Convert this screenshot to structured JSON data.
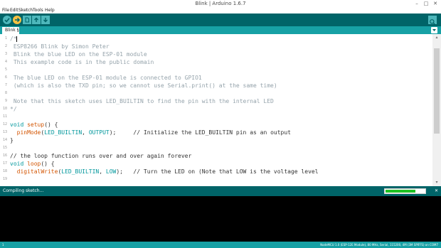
{
  "window": {
    "title": "Blink | Arduino 1.6.7"
  },
  "menu": [
    "File",
    "Edit",
    "Sketch",
    "Tools",
    "Help"
  ],
  "tabs": [
    {
      "label": "Blink §"
    }
  ],
  "editor": {
    "lines": [
      {
        "n": "1",
        "segs": [
          {
            "t": "/*",
            "c": "cm"
          }
        ]
      },
      {
        "n": "2",
        "segs": [
          {
            "t": " ESP8266 Blink by Simon Peter",
            "c": "cm"
          }
        ]
      },
      {
        "n": "3",
        "segs": [
          {
            "t": " Blink the blue LED on the ESP-01 module",
            "c": "cm"
          }
        ]
      },
      {
        "n": "4",
        "segs": [
          {
            "t": " This example code is in the public domain",
            "c": "cm"
          }
        ]
      },
      {
        "n": "5",
        "segs": []
      },
      {
        "n": "6",
        "segs": [
          {
            "t": " The blue LED on the ESP-01 module is connected to GPIO1",
            "c": "cm"
          }
        ]
      },
      {
        "n": "7",
        "segs": [
          {
            "t": " (which is also the TXD pin; so we cannot use Serial.print() at the same time)",
            "c": "cm"
          }
        ]
      },
      {
        "n": "8",
        "segs": []
      },
      {
        "n": "9",
        "segs": [
          {
            "t": " Note that this sketch uses LED_BUILTIN to find the pin with the internal LED",
            "c": "cm"
          }
        ]
      },
      {
        "n": "10",
        "segs": [
          {
            "t": "*/",
            "c": "cm"
          }
        ]
      },
      {
        "n": "11",
        "segs": []
      },
      {
        "n": "12",
        "segs": [
          {
            "t": "void",
            "c": "kw"
          },
          {
            "t": " "
          },
          {
            "t": "setup",
            "c": "fn"
          },
          {
            "t": "() {"
          }
        ]
      },
      {
        "n": "13",
        "segs": [
          {
            "t": "  "
          },
          {
            "t": "pinMode",
            "c": "fn"
          },
          {
            "t": "("
          },
          {
            "t": "LED_BUILTIN",
            "c": "cn"
          },
          {
            "t": ", "
          },
          {
            "t": "OUTPUT",
            "c": "cn"
          },
          {
            "t": ");     // Initialize the LED_BUILTIN pin as an output"
          }
        ]
      },
      {
        "n": "14",
        "segs": [
          {
            "t": "}"
          }
        ]
      },
      {
        "n": "15",
        "segs": []
      },
      {
        "n": "16",
        "segs": [
          {
            "t": "// the loop function runs over and over again forever"
          }
        ]
      },
      {
        "n": "17",
        "segs": [
          {
            "t": "void",
            "c": "kw"
          },
          {
            "t": " "
          },
          {
            "t": "loop",
            "c": "fn"
          },
          {
            "t": "() {"
          }
        ]
      },
      {
        "n": "18",
        "segs": [
          {
            "t": "  "
          },
          {
            "t": "digitalWrite",
            "c": "fn"
          },
          {
            "t": "("
          },
          {
            "t": "LED_BUILTIN",
            "c": "cn"
          },
          {
            "t": ", "
          },
          {
            "t": "LOW",
            "c": "cn"
          },
          {
            "t": ");   // Turn the LED on (Note that LOW is the voltage level"
          }
        ]
      },
      {
        "n": "19",
        "segs": []
      }
    ]
  },
  "status": {
    "message": "Compiling sketch...",
    "progress": 0.77
  },
  "footer": {
    "line": "1",
    "board": "NodeMCU 1.0 (ESP-12E Module), 80 MHz, Serial, 115200, 4M (3M SPIFFS) on COM7"
  },
  "colors": {
    "toolbar": "#006468",
    "tabbar": "#17a1a5",
    "progress": "#1ec223"
  }
}
